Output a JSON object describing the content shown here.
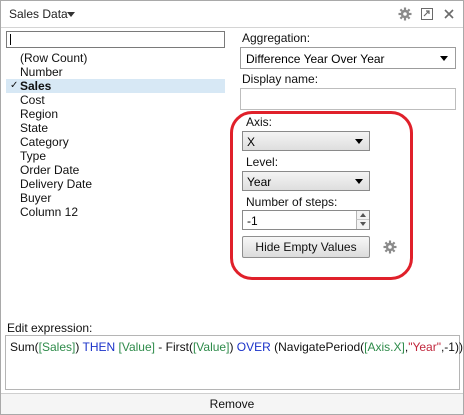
{
  "title": "Sales Data",
  "list": {
    "search_value": "",
    "items": [
      {
        "label": "(Row Count)",
        "selected": false
      },
      {
        "label": "Number",
        "selected": false
      },
      {
        "label": "Sales",
        "selected": true
      },
      {
        "label": "Cost",
        "selected": false
      },
      {
        "label": "Region",
        "selected": false
      },
      {
        "label": "State",
        "selected": false
      },
      {
        "label": "Category",
        "selected": false
      },
      {
        "label": "Type",
        "selected": false
      },
      {
        "label": "Order Date",
        "selected": false
      },
      {
        "label": "Delivery Date",
        "selected": false
      },
      {
        "label": "Buyer",
        "selected": false
      },
      {
        "label": "Column 12",
        "selected": false
      }
    ]
  },
  "aggregation": {
    "label": "Aggregation:",
    "value": "Difference Year Over Year"
  },
  "display_name": {
    "label": "Display name:",
    "value": ""
  },
  "axis": {
    "label": "Axis:",
    "value": "X"
  },
  "level": {
    "label": "Level:",
    "value": "Year"
  },
  "steps": {
    "label": "Number of steps:",
    "value": "-1"
  },
  "hide_empty_button": "Hide Empty Values",
  "expression": {
    "label": "Edit expression:",
    "tokens": [
      {
        "text": "Sum(",
        "kind": "fn"
      },
      {
        "text": "[Sales]",
        "kind": "col"
      },
      {
        "text": ") ",
        "kind": "fn"
      },
      {
        "text": "THEN",
        "kind": "kw"
      },
      {
        "text": " ",
        "kind": "fn"
      },
      {
        "text": "[Value]",
        "kind": "col"
      },
      {
        "text": " - First(",
        "kind": "fn"
      },
      {
        "text": "[Value]",
        "kind": "col"
      },
      {
        "text": ") ",
        "kind": "fn"
      },
      {
        "text": "OVER",
        "kind": "kw"
      },
      {
        "text": " (NavigatePeriod(",
        "kind": "fn"
      },
      {
        "text": "[Axis.X]",
        "kind": "col"
      },
      {
        "text": ",",
        "kind": "fn"
      },
      {
        "text": "\"Year\"",
        "kind": "str"
      },
      {
        "text": ",-1))",
        "kind": "fn"
      }
    ]
  },
  "remove_button": "Remove",
  "icons": {
    "title_caret": "chevron-down-icon",
    "settings": "gear-icon",
    "popout": "popout-icon",
    "close": "close-icon",
    "options": "gear-icon",
    "selected_marker": "check-icon"
  },
  "colors": {
    "highlight": "#e0202a",
    "keyword": "#1a32c9",
    "column": "#2e8b4a",
    "string": "#c0263c",
    "selected_row": "#d7e8f5"
  }
}
